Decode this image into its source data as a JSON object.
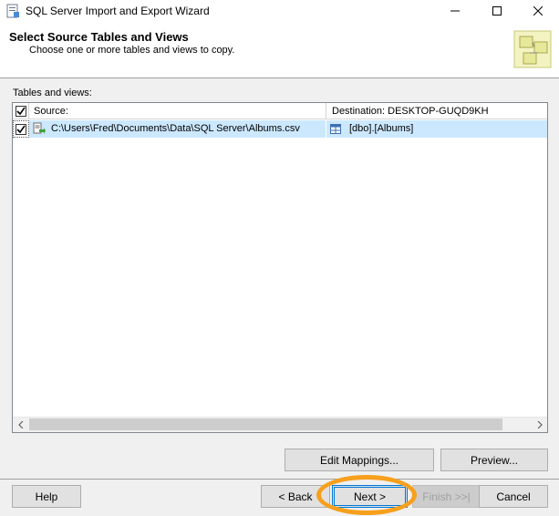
{
  "window": {
    "title": "SQL Server Import and Export Wizard",
    "app_icon": "wizard-app-icon",
    "controls": [
      "minimize-icon",
      "maximize-icon",
      "close-icon"
    ]
  },
  "header": {
    "title": "Select Source Tables and Views",
    "subtitle": "Choose one or more tables and views to copy."
  },
  "tables": {
    "label": "Tables and views:",
    "columns": {
      "source": "Source:",
      "destination": "Destination: DESKTOP-GUQD9KH"
    },
    "header_checked": true,
    "rows": [
      {
        "checked": true,
        "source": "C:\\Users\\Fred\\Documents\\Data\\SQL Server\\Albums.csv",
        "destination": "[dbo].[Albums]",
        "selected": true
      }
    ]
  },
  "actions": {
    "edit_mappings": "Edit Mappings...",
    "preview": "Preview..."
  },
  "footer": {
    "help": "Help",
    "back": "< Back",
    "next": "Next >",
    "finish": "Finish >>|",
    "cancel": "Cancel"
  },
  "colors": {
    "selection": "#cce8ff",
    "focus_border": "#0078d7",
    "highlight_annotation": "#f7a01d"
  }
}
